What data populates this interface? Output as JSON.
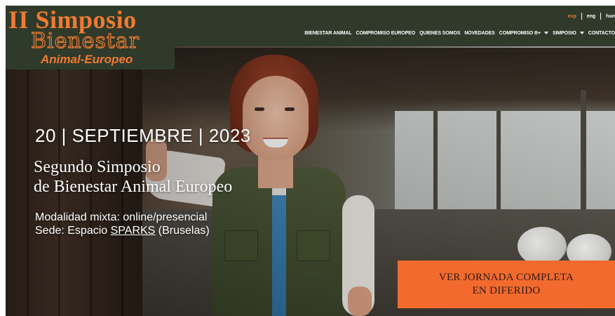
{
  "logo": {
    "line1": "II Simposio",
    "line2": "Bienestar",
    "line3": "Animal-Europeo"
  },
  "languages": [
    {
      "label": "esp",
      "active": true
    },
    {
      "label": "eng",
      "active": false
    },
    {
      "label": "hun",
      "active": false
    }
  ],
  "nav": {
    "items": [
      {
        "label": "BIENESTAR ANIMAL",
        "dropdown": false
      },
      {
        "label": "COMPROMISO EUROPEO",
        "dropdown": false
      },
      {
        "label": "QUIENES SOMOS",
        "dropdown": false
      },
      {
        "label": "NOVEDADES",
        "dropdown": false
      },
      {
        "label": "COMPROMISO B+",
        "dropdown": true
      },
      {
        "label": "SIMPOSIO",
        "dropdown": true
      },
      {
        "label": "CONTACTO",
        "dropdown": false
      }
    ]
  },
  "hero": {
    "date": "20 | SEPTIEMBRE | 2023",
    "heading_line1": "Segundo Simposio",
    "heading_line2": "de Bienestar Animal Europeo",
    "modality": "Modalidad mixta: online/presencial",
    "venue_prefix": "Sede: Espacio ",
    "venue_link": "SPARKS",
    "venue_suffix": " (Bruselas)"
  },
  "cta": {
    "line1": "VER JORNADA COMPLETA",
    "line2": "EN DIFERIDO"
  },
  "colors": {
    "accent": "#f07a31",
    "cta_bg": "#f26a2e",
    "nav_bg": "#2f3a2a"
  }
}
